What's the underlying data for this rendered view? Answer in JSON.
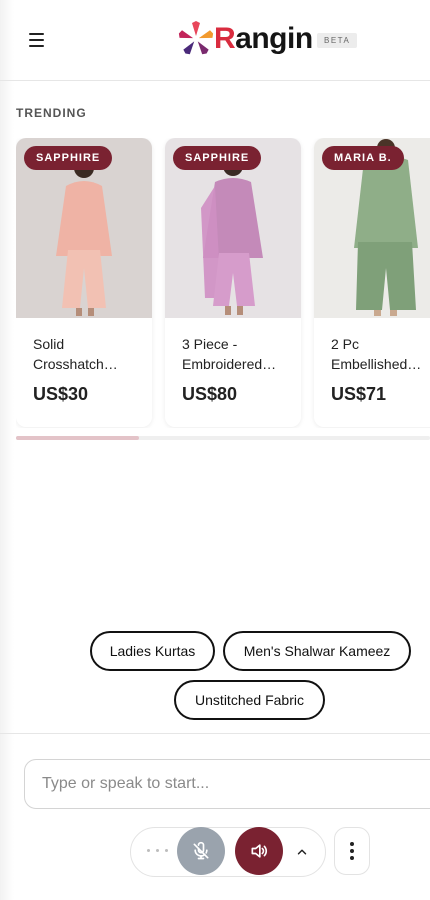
{
  "app": {
    "brand_name": "Rangin",
    "brand_initial": "R",
    "brand_rest": "angin",
    "beta_label": "BETA"
  },
  "trending": {
    "title": "TRENDING",
    "products": [
      {
        "brand": "SAPPHIRE",
        "name_line1": "Solid",
        "name_line2": "Crosshatch…",
        "price": "US$30",
        "color": "#f1bdb0"
      },
      {
        "brand": "SAPPHIRE",
        "name_line1": "3 Piece -",
        "name_line2": "Embroidered…",
        "price": "US$80",
        "color": "#c983bd"
      },
      {
        "brand": "MARIA B.",
        "name_line1": "2 Pc",
        "name_line2": "Embellished…",
        "price": "US$71",
        "color": "#8fae88"
      }
    ]
  },
  "suggestions": [
    "Ladies Kurtas",
    "Men's Shalwar Kameez",
    "Unstitched Fabric"
  ],
  "composer": {
    "placeholder": "Type or speak to start..."
  },
  "colors": {
    "accent": "#7a2231",
    "mic_muted": "#9aa3ad",
    "scroll_thumb": "#e3c3c8"
  },
  "icons": [
    "menu-icon",
    "logo-flower-icon",
    "mic-off-icon",
    "speaker-icon",
    "chevron-up-icon",
    "more-vertical-icon"
  ]
}
